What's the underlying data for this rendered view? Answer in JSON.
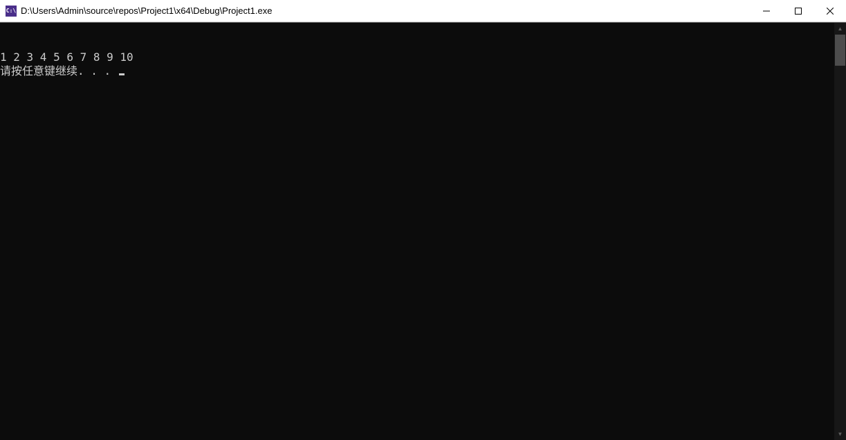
{
  "titlebar": {
    "icon_text": "C:\\",
    "title": "D:\\Users\\Admin\\source\\repos\\Project1\\x64\\Debug\\Project1.exe"
  },
  "console": {
    "line1": "1 2 3 4 5 6 7 8 9 10",
    "line2": "请按任意键继续. . . "
  }
}
